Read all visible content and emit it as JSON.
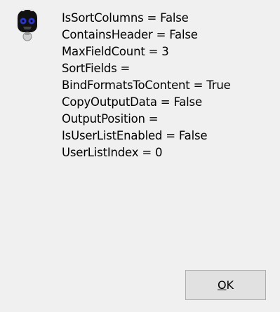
{
  "message": {
    "lines": [
      "IsSortColumns = False",
      "ContainsHeader = False",
      "MaxFieldCount = 3",
      "SortFields =",
      "BindFormatsToContent = True",
      "CopyOutputData = False",
      "OutputPosition =",
      "IsUserListEnabled = False",
      "UserListIndex = 0"
    ]
  },
  "ok_button": {
    "accelerator": "O",
    "rest": "K"
  },
  "icon": "skull-mascot-icon"
}
